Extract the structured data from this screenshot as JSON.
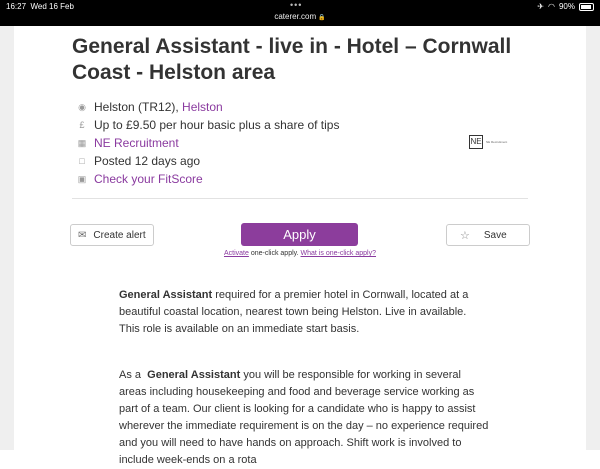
{
  "status_bar": {
    "time": "16:27",
    "date": "Wed 16 Feb",
    "url": "caterer.com",
    "battery": "90%",
    "battery_level": 0.9
  },
  "job": {
    "title": "General Assistant - live in - Hotel – Cornwall Coast - Helston area",
    "location_text": "Helston (TR12),",
    "location_link": "Helston",
    "salary": "Up to £9.50 per hour basic plus a share of tips",
    "recruiter": "NE Recruitment",
    "posted": "Posted 12 days ago",
    "fitscore": "Check your FitScore"
  },
  "logo": {
    "mark": "NE",
    "text": "NE Recruitment"
  },
  "actions": {
    "create_alert": "Create alert",
    "apply": "Apply",
    "save": "Save",
    "activate": "Activate",
    "one_click_text": "one-click apply.",
    "what_is": "What is one-click apply?"
  },
  "description": {
    "p1_bold": "General Assistant",
    "p1_rest": " required for a premier hotel in Cornwall, located at a beautiful coastal location, nearest town being Helston. Live in available. This role is available on an immediate start basis.",
    "p2_prefix": "As a ",
    "p2_bold": "General Assistant",
    "p2_rest": " you will be responsible for working in several areas including housekeeping and food and beverage service working as part of a team. Our client is looking for a candidate who is happy to assist wherever the immediate requirement is on the day – no experience required and you will need to have hands on approach. Shift work is involved to include week-ends on a rota"
  },
  "colors": {
    "accent": "#8c3d9c",
    "link": "#8a3a9f",
    "status_bar": "#000000"
  },
  "icons": [
    "location-pin-icon",
    "pound-icon",
    "building-icon",
    "calendar-icon",
    "fitscore-icon",
    "envelope-icon",
    "star-icon",
    "lock-icon",
    "wifi-icon",
    "battery-icon"
  ]
}
